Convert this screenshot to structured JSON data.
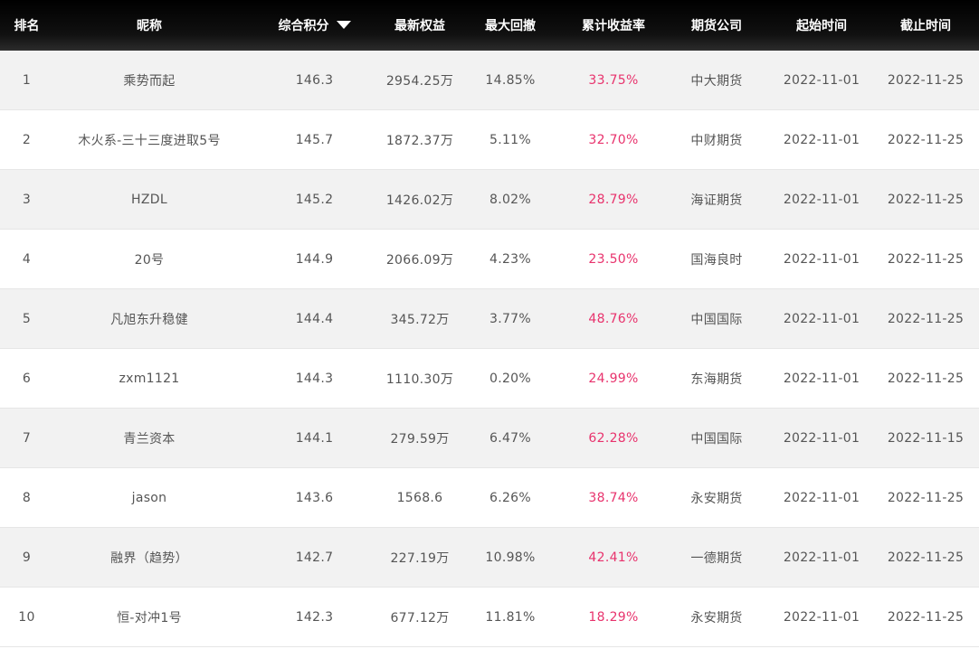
{
  "header": {
    "rank": "排名",
    "nickname": "昵称",
    "score": "综合积分",
    "equity": "最新权益",
    "drawdown": "最大回撤",
    "return": "累计收益率",
    "company": "期货公司",
    "start": "起始时间",
    "end": "截止时间"
  },
  "colors": {
    "header_bg": "#000000",
    "return_text": "#e8336d",
    "row_alt": "#f2f2f2"
  },
  "rows": [
    {
      "rank": "1",
      "nickname": "乘势而起",
      "score": "146.3",
      "equity": "2954.25万",
      "drawdown": "14.85%",
      "return": "33.75%",
      "company": "中大期货",
      "start": "2022-11-01",
      "end": "2022-11-25"
    },
    {
      "rank": "2",
      "nickname": "木火系-三十三度进取5号",
      "score": "145.7",
      "equity": "1872.37万",
      "drawdown": "5.11%",
      "return": "32.70%",
      "company": "中财期货",
      "start": "2022-11-01",
      "end": "2022-11-25"
    },
    {
      "rank": "3",
      "nickname": "HZDL",
      "score": "145.2",
      "equity": "1426.02万",
      "drawdown": "8.02%",
      "return": "28.79%",
      "company": "海证期货",
      "start": "2022-11-01",
      "end": "2022-11-25"
    },
    {
      "rank": "4",
      "nickname": "20号",
      "score": "144.9",
      "equity": "2066.09万",
      "drawdown": "4.23%",
      "return": "23.50%",
      "company": "国海良时",
      "start": "2022-11-01",
      "end": "2022-11-25"
    },
    {
      "rank": "5",
      "nickname": "凡旭东升稳健",
      "score": "144.4",
      "equity": "345.72万",
      "drawdown": "3.77%",
      "return": "48.76%",
      "company": "中国国际",
      "start": "2022-11-01",
      "end": "2022-11-25"
    },
    {
      "rank": "6",
      "nickname": "zxm1121",
      "score": "144.3",
      "equity": "1110.30万",
      "drawdown": "0.20%",
      "return": "24.99%",
      "company": "东海期货",
      "start": "2022-11-01",
      "end": "2022-11-25"
    },
    {
      "rank": "7",
      "nickname": "青兰资本",
      "score": "144.1",
      "equity": "279.59万",
      "drawdown": "6.47%",
      "return": "62.28%",
      "company": "中国国际",
      "start": "2022-11-01",
      "end": "2022-11-15"
    },
    {
      "rank": "8",
      "nickname": "jason",
      "score": "143.6",
      "equity": "1568.6",
      "drawdown": "6.26%",
      "return": "38.74%",
      "company": "永安期货",
      "start": "2022-11-01",
      "end": "2022-11-25"
    },
    {
      "rank": "9",
      "nickname": "融界（趋势）",
      "score": "142.7",
      "equity": "227.19万",
      "drawdown": "10.98%",
      "return": "42.41%",
      "company": "一德期货",
      "start": "2022-11-01",
      "end": "2022-11-25"
    },
    {
      "rank": "10",
      "nickname": "恒-对冲1号",
      "score": "142.3",
      "equity": "677.12万",
      "drawdown": "11.81%",
      "return": "18.29%",
      "company": "永安期货",
      "start": "2022-11-01",
      "end": "2022-11-25"
    }
  ]
}
